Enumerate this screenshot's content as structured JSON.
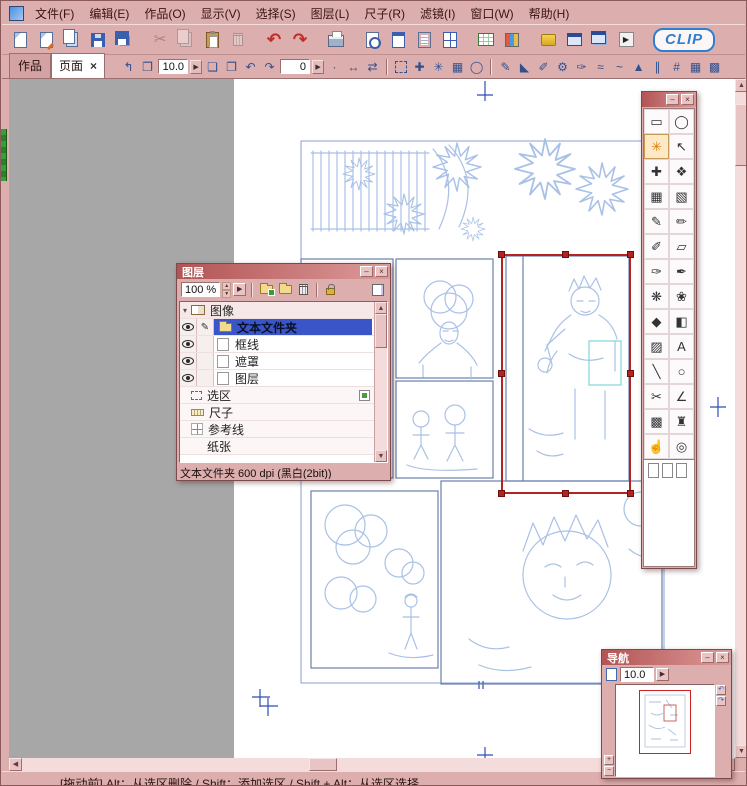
{
  "colors": {
    "chrome": "#dcaeae",
    "chrome-dark": "#c89090",
    "title-a": "#b25454",
    "title-b": "#dd9a9a",
    "menu-text": "#3a1414",
    "canvas-gray": "#a7a7a7",
    "sketch-blue": "#a9c1e6",
    "panel-blue": "#6b80ab",
    "guide-blue": "#2e4cb2",
    "frame-blue": "#8ba0d0",
    "selection-red": "#b32420",
    "row-blue": "#3a55c8",
    "clip-blue": "#2f7fd0",
    "cyan-box": "#7fd4da"
  },
  "icons": {
    "play": "▶",
    "close": "×",
    "minimize": "–",
    "scroll_up": "▲",
    "scroll_down": "▼",
    "scroll_left": "◀",
    "scroll_right": "▶",
    "pen": "✎",
    "rotate_ccw": "↶",
    "rotate_cw": "↷",
    "plus": "+",
    "minus": "−",
    "expander": "▾"
  },
  "menubar": {
    "items": [
      {
        "name": "menu-file",
        "label": "文件(F)"
      },
      {
        "name": "menu-edit",
        "label": "编辑(E)"
      },
      {
        "name": "menu-work",
        "label": "作品(O)"
      },
      {
        "name": "menu-view",
        "label": "显示(V)"
      },
      {
        "name": "menu-select",
        "label": "选择(S)"
      },
      {
        "name": "menu-layer",
        "label": "图层(L)"
      },
      {
        "name": "menu-ruler",
        "label": "尺子(R)"
      },
      {
        "name": "menu-filter",
        "label": "滤镜(I)"
      },
      {
        "name": "menu-window",
        "label": "窗口(W)"
      },
      {
        "name": "menu-help",
        "label": "帮助(H)"
      }
    ]
  },
  "toolbar": {
    "logo": "CLIP",
    "buttons": [
      {
        "name": "new-page-button",
        "kind": "ic-doc",
        "glyph": ""
      },
      {
        "name": "new-work-button",
        "kind": "ic-docpen",
        "glyph": ""
      },
      {
        "name": "open-button",
        "kind": "ic-docs",
        "glyph": ""
      },
      {
        "name": "save-button",
        "kind": "ic-floppy",
        "glyph": ""
      },
      {
        "name": "save-all-button",
        "kind": "ic-floppy2",
        "glyph": ""
      },
      {
        "name": "cut-button",
        "kind": "ic-cut",
        "glyph": "✂",
        "state": "disabled",
        "sp": "sp"
      },
      {
        "name": "copy-button",
        "kind": "ic-copy",
        "glyph": "",
        "state": "disabled"
      },
      {
        "name": "paste-button",
        "kind": "ic-paste",
        "glyph": ""
      },
      {
        "name": "delete-button",
        "kind": "ic-trash",
        "glyph": "",
        "state": "disabled"
      },
      {
        "name": "undo-button",
        "kind": "ic-undo",
        "glyph": "↶",
        "sp": "sp"
      },
      {
        "name": "redo-button",
        "kind": "ic-redo",
        "glyph": "↷"
      },
      {
        "name": "print-button",
        "kind": "ic-print",
        "glyph": "",
        "sp": "sp"
      },
      {
        "name": "print-preview-button",
        "kind": "ic-preview",
        "glyph": "",
        "sp": "sp"
      },
      {
        "name": "page-view-button",
        "kind": "ic-pageview",
        "glyph": ""
      },
      {
        "name": "story-view-button",
        "kind": "ic-storyview",
        "glyph": ""
      },
      {
        "name": "layout-view-button",
        "kind": "ic-layoutview",
        "glyph": ""
      },
      {
        "name": "table-button",
        "kind": "ic-table",
        "glyph": "",
        "sp": "sp"
      },
      {
        "name": "grid-button",
        "kind": "ic-grid",
        "glyph": ""
      },
      {
        "name": "materials-button",
        "kind": "ic-palette",
        "glyph": "",
        "sp": "sp"
      },
      {
        "name": "window-button",
        "kind": "ic-win",
        "glyph": ""
      },
      {
        "name": "window2-button",
        "kind": "ic-win2",
        "glyph": ""
      },
      {
        "name": "play-button",
        "kind": "ic-play",
        "glyph": "▶"
      }
    ]
  },
  "optionsbar": {
    "works_label": "作品",
    "page_tab": "页面",
    "page_tab_close": "×",
    "controls": [
      {
        "t": "c-icon",
        "n": "page-step-icon",
        "g": "↰"
      },
      {
        "t": "c-icon",
        "n": "spread-icon",
        "g": "❐"
      },
      {
        "t": "c-value",
        "n": "zoom-value",
        "g": "10.0"
      },
      {
        "t": "c-btn",
        "n": "zoom-menu-icon",
        "g": "▶"
      },
      {
        "t": "c-icon",
        "n": "page-doc-icon",
        "g": "❏"
      },
      {
        "t": "c-icon",
        "n": "page-export-icon",
        "g": "❐"
      },
      {
        "t": "c-icon",
        "n": "rotate-ccw-icon",
        "g": "↶"
      },
      {
        "t": "c-icon",
        "n": "rotate-cw-icon",
        "g": "↷"
      },
      {
        "t": "c-value",
        "n": "rotation-value",
        "g": "0"
      },
      {
        "t": "c-btn",
        "n": "rotation-menu-icon",
        "g": "▶"
      },
      {
        "t": "c-icon",
        "n": "dot-icon",
        "g": "·"
      },
      {
        "t": "c-icon",
        "n": "flip-h-icon",
        "g": "↔"
      },
      {
        "t": "c-icon",
        "n": "fit-icon",
        "g": "⇄"
      },
      {
        "t": "c-sep",
        "n": "separator",
        "g": "",
        "ni": true
      },
      {
        "t": "c-boxicon",
        "n": "select-frame-icon",
        "g": ""
      },
      {
        "t": "c-icon",
        "n": "move-selection-icon",
        "g": "✚"
      },
      {
        "t": "c-icon",
        "n": "wand-selection-icon",
        "g": "✳"
      },
      {
        "t": "c-icon",
        "n": "grid-selection-icon",
        "g": "▦"
      },
      {
        "t": "c-icon",
        "n": "lasso-selection-icon",
        "g": "◯"
      },
      {
        "t": "c-sep",
        "n": "separator",
        "g": "",
        "ni": true
      },
      {
        "t": "c-icon",
        "n": "pen-option-icon",
        "g": "✎"
      },
      {
        "t": "c-icon",
        "n": "triangle-option-icon",
        "g": "◣"
      },
      {
        "t": "c-icon",
        "n": "marker-option-icon",
        "g": "✐"
      },
      {
        "t": "c-icon",
        "n": "gear-icon",
        "g": "⚙"
      },
      {
        "t": "c-icon",
        "n": "brush-option-icon",
        "g": "✑"
      },
      {
        "t": "c-icon",
        "n": "wave-icon",
        "g": "≈"
      },
      {
        "t": "c-icon",
        "n": "curve-icon",
        "g": "~"
      },
      {
        "t": "c-icon",
        "n": "triangle2-icon",
        "g": "▲"
      },
      {
        "t": "c-icon",
        "n": "parallel-icon",
        "g": "∥"
      },
      {
        "t": "c-icon",
        "n": "hash-icon",
        "g": "#"
      },
      {
        "t": "c-icon",
        "n": "grid-a-icon",
        "g": "▦"
      },
      {
        "t": "c-icon",
        "n": "grid-b-icon",
        "g": "▩"
      }
    ]
  },
  "layers": {
    "title": "图层",
    "opacity": "100 %",
    "group_label": "图像",
    "selected_label": "文本文件夹",
    "row_frame": "框线",
    "row_mask": "遮罩",
    "row_layer": "图层",
    "row_selection": "选区",
    "row_ruler": "尺子",
    "row_guide": "参考线",
    "row_paper": "纸张",
    "status": "文本文件夹 600 dpi (黑白(2bit))"
  },
  "toolbox": {
    "title": "",
    "tools": [
      {
        "n": "marquee-tool",
        "g": "▭"
      },
      {
        "n": "lasso-tool",
        "g": "◯"
      },
      {
        "n": "magic-wand-tool",
        "g": "✳",
        "sel": "selected"
      },
      {
        "n": "object-select-tool",
        "g": "↖"
      },
      {
        "n": "move-tool",
        "g": "✚"
      },
      {
        "n": "layer-move-tool",
        "g": "❖"
      },
      {
        "n": "panel-tool",
        "g": "▦"
      },
      {
        "n": "perspective-tool",
        "g": "▧"
      },
      {
        "n": "pen-tool",
        "g": "✎"
      },
      {
        "n": "pencil-tool",
        "g": "✏"
      },
      {
        "n": "marker-tool",
        "g": "✐"
      },
      {
        "n": "eraser-tool",
        "g": "▱"
      },
      {
        "n": "brush-tool",
        "g": "✑"
      },
      {
        "n": "airbrush-tool",
        "g": "✒"
      },
      {
        "n": "pattern-brush-tool",
        "g": "❋"
      },
      {
        "n": "decoration-tool",
        "g": "❀"
      },
      {
        "n": "ink-tool",
        "g": "◆"
      },
      {
        "n": "fill-tool",
        "g": "◧"
      },
      {
        "n": "gradient-tool",
        "g": "▨"
      },
      {
        "n": "text-tool",
        "g": "A"
      },
      {
        "n": "line-tool",
        "g": "╲"
      },
      {
        "n": "shape-tool",
        "g": "○"
      },
      {
        "n": "tone-cutter-tool",
        "g": "✂"
      },
      {
        "n": "ruler-tool",
        "g": "∠"
      },
      {
        "n": "tone-tool",
        "g": "▩"
      },
      {
        "n": "stamp-tool",
        "g": "♜"
      },
      {
        "n": "hand-tool",
        "g": "☝"
      },
      {
        "n": "zoom-tool",
        "g": "◎"
      }
    ]
  },
  "navigator": {
    "title": "导航",
    "zoom": "10.0"
  },
  "statusbar": {
    "text": "[拖动前] Alt：从选区删除 / Shift：添加选区 / Shift + Alt：从选区选择"
  }
}
